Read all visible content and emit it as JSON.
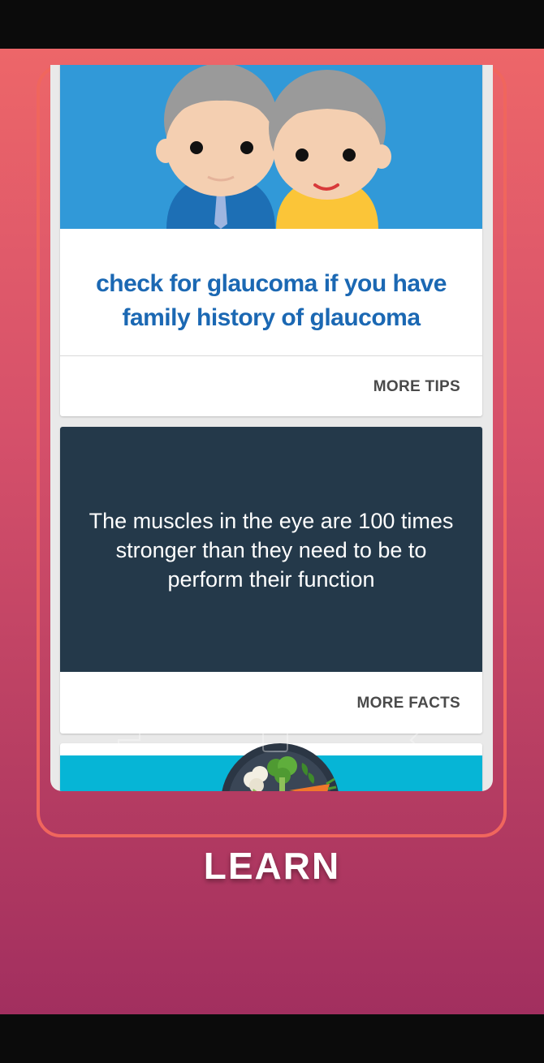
{
  "tip_card": {
    "illustration": "elderly-couple-illustration",
    "text": "check for glaucoma if you have family history of glaucoma",
    "action_label": "MORE TIPS"
  },
  "fact_card": {
    "text": "The muscles in the eye are 100 times stronger than they need to be to perform their function",
    "action_label": "MORE FACTS"
  },
  "food_card": {
    "illustration": "vegetable-plate-illustration"
  },
  "nav_icons": [
    "back-icon",
    "home-icon",
    "recents-icon"
  ],
  "caption": "LEARN",
  "colors": {
    "gradient_top": "#ed6669",
    "gradient_bottom": "#a22f5f",
    "frame_border": "#f0665d",
    "tip_banner": "#3199d8",
    "tip_text": "#1b68b3",
    "fact_panel": "#24394a",
    "food_banner": "#06b5d6"
  }
}
